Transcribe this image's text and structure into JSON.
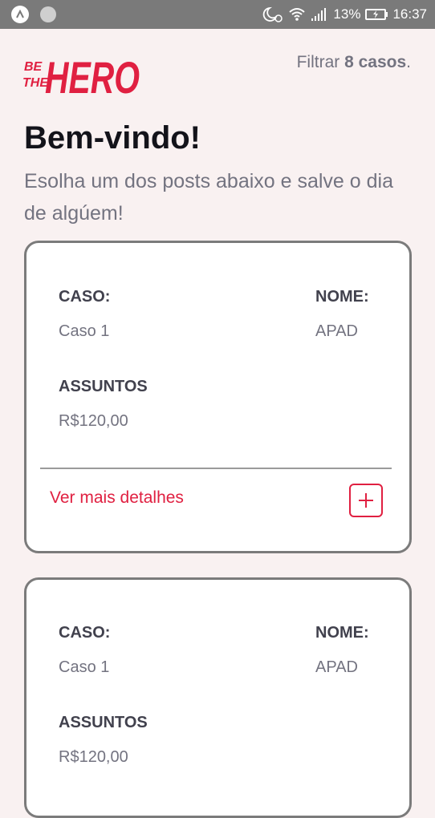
{
  "status_bar": {
    "battery_percent": "13%",
    "time": "16:37",
    "icons": [
      "app-icon",
      "dot-icon",
      "moon-alarm-icon",
      "wifi-icon",
      "signal-icon",
      "battery-charging-icon"
    ]
  },
  "header": {
    "logo_line1": "BE",
    "logo_line2": "THE",
    "logo_word": "HERO",
    "filter_prefix": "Filtrar",
    "filter_count": "8 casos",
    "filter_suffix": "."
  },
  "main": {
    "title": "Bem-vindo!",
    "subtitle": "Esolha um dos posts abaixo e salve o dia de algúem!"
  },
  "cases": [
    {
      "caso_label": "CASO:",
      "caso_value": "Caso 1",
      "nome_label": "NOME:",
      "nome_value": "APAD",
      "assuntos_label": "ASSUNTOS",
      "assuntos_value": "R$120,00",
      "details_label": "Ver mais detalhes"
    },
    {
      "caso_label": "CASO:",
      "caso_value": "Caso 1",
      "nome_label": "NOME:",
      "nome_value": "APAD",
      "assuntos_label": "ASSUNTOS",
      "assuntos_value": "R$120,00"
    }
  ],
  "colors": {
    "accent": "#e02041",
    "background": "#f9f1f1",
    "status_bar": "#7a7a7a"
  }
}
